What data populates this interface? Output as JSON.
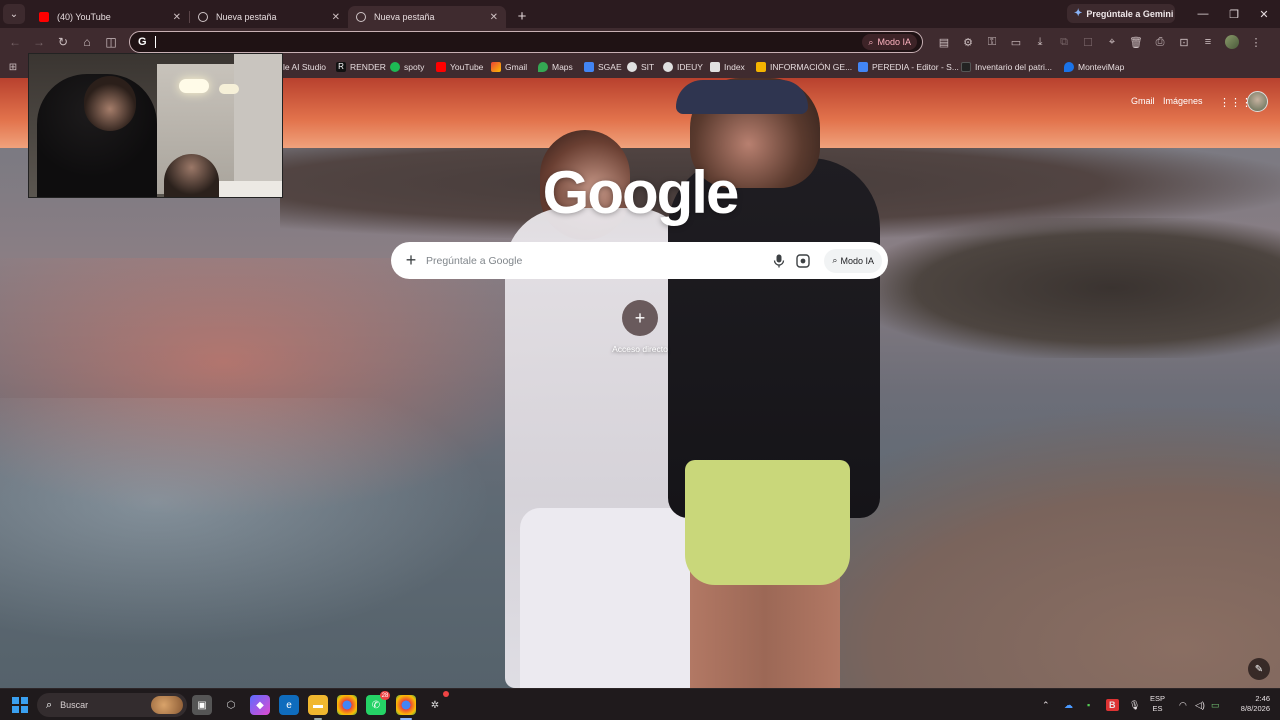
{
  "browser": {
    "tabs": [
      {
        "label": "(40) YouTube",
        "icon": "youtube-icon",
        "active": false
      },
      {
        "label": "Nueva pestaña",
        "icon": "chrome-icon",
        "active": false
      },
      {
        "label": "Nueva pestaña",
        "icon": "chrome-icon",
        "active": true
      }
    ],
    "gemini_button": "Pregúntale a Gemini",
    "omnibox": {
      "value": "",
      "modo_label": "Modo IA"
    },
    "bookmarks": [
      {
        "label": "le AI Studio",
        "icon": "ai-studio-icon",
        "color": "#8ab4f8"
      },
      {
        "label": "RENDER",
        "icon": "render-icon",
        "color": "#ffffff"
      },
      {
        "label": "spoty",
        "icon": "spotify-icon",
        "color": "#1db954"
      },
      {
        "label": "YouTube",
        "icon": "youtube-icon",
        "color": "#ff0000"
      },
      {
        "label": "Gmail",
        "icon": "gmail-icon",
        "color": "#ea4335"
      },
      {
        "label": "Maps",
        "icon": "maps-icon",
        "color": "#34a853"
      },
      {
        "label": "SGAE",
        "icon": "sgae-icon",
        "color": "#4285f4"
      },
      {
        "label": "SIT",
        "icon": "sit-icon",
        "color": "#e0e0e0"
      },
      {
        "label": "IDEUY",
        "icon": "ideuy-icon",
        "color": "#e0e0e0"
      },
      {
        "label": "Index",
        "icon": "document-icon",
        "color": "#e0e0e0"
      },
      {
        "label": "INFORMACIÓN GE...",
        "icon": "info-icon",
        "color": "#f4b400"
      },
      {
        "label": "PEREDIA - Editor - S...",
        "icon": "editor-icon",
        "color": "#4285f4"
      },
      {
        "label": "Inventario del patri...",
        "icon": "inventory-icon",
        "color": "#222222"
      },
      {
        "label": "MonteviMap",
        "icon": "montevimap-icon",
        "color": "#1a73e8"
      }
    ]
  },
  "ntp": {
    "gmail_link": "Gmail",
    "images_link": "Imágenes",
    "logo": "Google",
    "search_placeholder": "Pregúntale a Google",
    "modo_ia": "Modo IA",
    "shortcut_label": "Acceso directo"
  },
  "taskbar": {
    "search_label": "Buscar",
    "whatsapp_badge": "28",
    "language": "ESP",
    "language_sub": "ES",
    "time": "2:46",
    "date": "8/8/2026"
  },
  "colors": {
    "tabstrip": "#2b1b1f",
    "toolbar": "#3f2b2f",
    "accent": "#ffb4c1",
    "taskbar": "#1f1a1c"
  }
}
